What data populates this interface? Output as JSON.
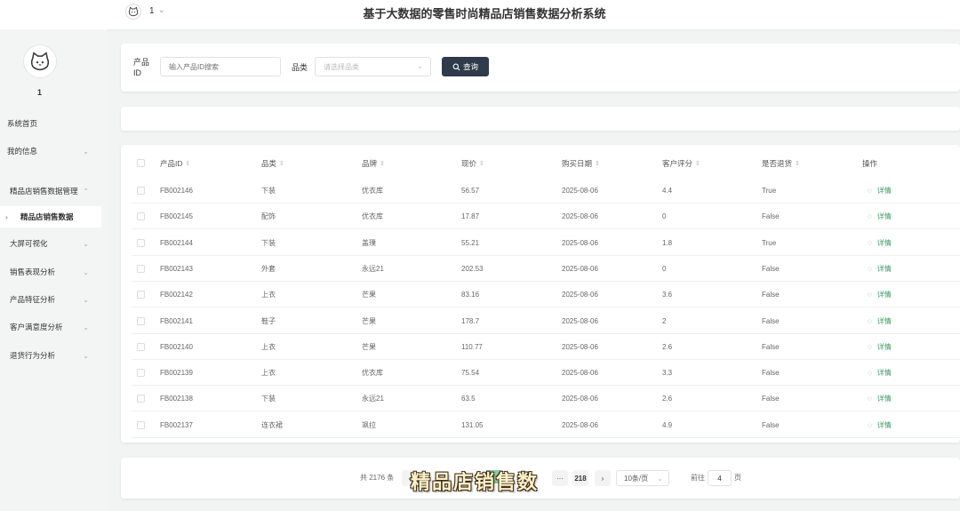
{
  "header": {
    "user_name": "1",
    "title": "基于大数据的零售时尚精品店销售数据分析系统"
  },
  "sidebar": {
    "user_name": "1",
    "items": [
      {
        "label": "系统首页",
        "arrow": ""
      },
      {
        "label": "我的信息",
        "arrow": "⌄"
      },
      {
        "label": "精品店销售数据管理",
        "arrow": "⌃"
      },
      {
        "label": "精品店销售数据",
        "arrow": "",
        "prefix": "›"
      },
      {
        "label": "大屏可视化",
        "arrow": "⌄"
      },
      {
        "label": "销售表现分析",
        "arrow": "⌄"
      },
      {
        "label": "产品特征分析",
        "arrow": "⌄"
      },
      {
        "label": "客户满意度分析",
        "arrow": "⌄"
      },
      {
        "label": "退货行为分析",
        "arrow": "⌄"
      }
    ]
  },
  "search": {
    "product_id_label": "产品ID",
    "product_id_placeholder": "输入产品ID搜索",
    "category_label": "品类",
    "category_placeholder": "请选择品类",
    "query_button": "查询"
  },
  "table": {
    "columns": [
      "产品ID",
      "品类",
      "品牌",
      "现价",
      "购买日期",
      "客户评分",
      "是否退货",
      "操作"
    ],
    "action_label": "详情",
    "rows": [
      [
        "FB002146",
        "下装",
        "优衣库",
        "56.57",
        "2025-08-06",
        "4.4",
        "True"
      ],
      [
        "FB002145",
        "配饰",
        "优衣库",
        "17.87",
        "2025-08-06",
        "0",
        "False"
      ],
      [
        "FB002144",
        "下装",
        "盖璞",
        "55.21",
        "2025-08-06",
        "1.8",
        "True"
      ],
      [
        "FB002143",
        "外套",
        "永远21",
        "202.53",
        "2025-08-06",
        "0",
        "False"
      ],
      [
        "FB002142",
        "上衣",
        "芒果",
        "83.16",
        "2025-08-06",
        "3.6",
        "False"
      ],
      [
        "FB002141",
        "鞋子",
        "芒果",
        "178.7",
        "2025-08-06",
        "2",
        "False"
      ],
      [
        "FB002140",
        "上衣",
        "芒果",
        "110.77",
        "2025-08-06",
        "2.6",
        "False"
      ],
      [
        "FB002139",
        "上衣",
        "优衣库",
        "75.54",
        "2025-08-06",
        "3.3",
        "False"
      ],
      [
        "FB002138",
        "下装",
        "永远21",
        "63.5",
        "2025-08-06",
        "2.6",
        "False"
      ],
      [
        "FB002137",
        "连衣裙",
        "飒拉",
        "131.05",
        "2025-08-06",
        "4.9",
        "False"
      ]
    ]
  },
  "pagination": {
    "total_text": "共 2176 条",
    "prev": "‹",
    "ellipsis": "···",
    "last_page": "218",
    "next": "›",
    "page_size": "10条/页",
    "goto_label": "前往",
    "goto_value": "4",
    "goto_suffix": "页"
  },
  "watermark": "精品店销售数"
}
